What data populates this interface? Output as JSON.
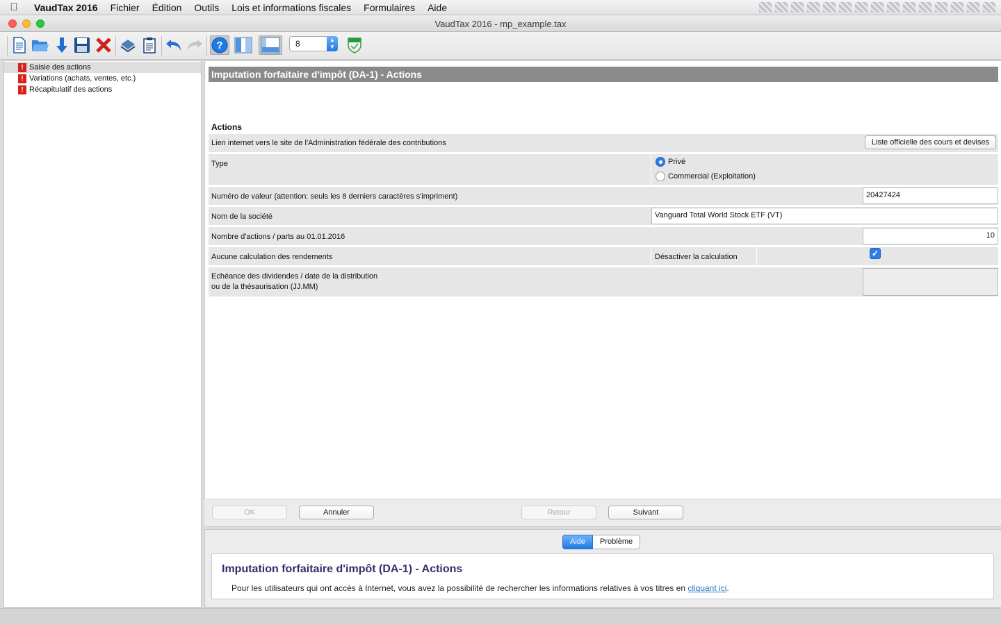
{
  "menubar": {
    "app_name": "VaudTax 2016",
    "items": [
      "Fichier",
      "Édition",
      "Outils",
      "Lois et informations fiscales",
      "Formulaires",
      "Aide"
    ]
  },
  "window": {
    "title": "VaudTax 2016 - mp_example.tax"
  },
  "toolbar": {
    "zoom_value": "8",
    "icons": [
      "new-document-icon",
      "open-folder-icon",
      "download-arrow-icon",
      "save-disk-icon",
      "delete-x-icon",
      "print-icon",
      "clipboard-icon",
      "undo-icon",
      "redo-icon",
      "help-icon",
      "sidebar-layout-icon",
      "bottom-panel-layout-icon",
      "vaud-shield-icon"
    ]
  },
  "sidebar": {
    "items": [
      {
        "label": "Saisie des actions",
        "selected": true
      },
      {
        "label": "Variations (achats, ventes, etc.)"
      },
      {
        "label": "Récapitulatif des actions"
      }
    ]
  },
  "form": {
    "header": "Imputation forfaitaire d'impôt (DA-1) - Actions",
    "section_title": "Actions",
    "row_link_label": "Lien internet vers le site de l'Administration fédérale des contributions",
    "link_button": "Liste officielle des cours et devises",
    "type_label": "Type",
    "type_options": [
      "Privé",
      "Commercial (Exploitation)"
    ],
    "type_selected": "Privé",
    "valor_label": "Numéro de valeur (attention: seuls les 8 derniers caractères s'impriment)",
    "valor_value": "20427424",
    "company_label": "Nom de la société",
    "company_value": "Vanguard Total World Stock ETF (VT)",
    "shares_label": "Nombre d'actions / parts au 01.01.2016",
    "shares_value": "10",
    "no_calc_label": "Aucune calculation des rendements",
    "disable_calc_label": "Désactiver la calculation",
    "disable_calc_checked": true,
    "dividend_label_line1": "Echéance des dividendes / date de la distribution",
    "dividend_label_line2": "ou de la thésaurisation (JJ.MM)",
    "dividend_value": ""
  },
  "buttons": {
    "ok": "OK",
    "cancel": "Annuler",
    "back": "Retour",
    "next": "Suivant"
  },
  "help": {
    "tabs": [
      "Aide",
      "Problème"
    ],
    "active_tab": "Aide",
    "title": "Imputation forfaitaire d'impôt (DA-1) - Actions",
    "text": "Pour les utilisateurs qui ont accès à Internet, vous avez la possibilité de rechercher les informations relatives à vos titres en ",
    "link": "cliquant ici",
    "text_end": "."
  },
  "colors": {
    "header_bg": "#8a8a8a",
    "accent_blue": "#2f7fe2",
    "warning_red": "#d6221b",
    "help_title": "#3a2a6b"
  }
}
